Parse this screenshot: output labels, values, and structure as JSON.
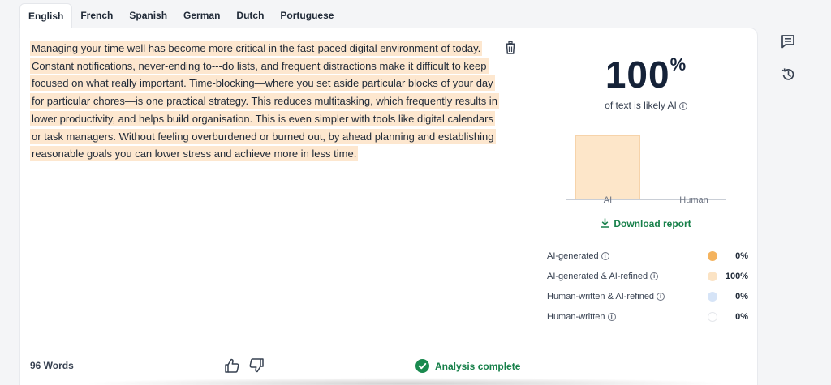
{
  "tabs": [
    {
      "label": "English",
      "active": true
    },
    {
      "label": "French"
    },
    {
      "label": "Spanish"
    },
    {
      "label": "German"
    },
    {
      "label": "Dutch"
    },
    {
      "label": "Portuguese"
    }
  ],
  "editor": {
    "text": "Managing your time well has become more critical in the fast-paced digital environment of today. Constant notifications, never-ending to---do lists, and frequent distractions make it difficult to keep focused on what really important. Time-blocking—where you set aside particular blocks of your day for particular chores—is one practical strategy. This reduces multitasking, which frequently results in lower productivity, and helps build organisation. This is even simpler with tools like digital calendars or task managers. Without feeling overburdened or burned out, by ahead planning and establishing reasonable goals you can lower stress and achieve more in less time.",
    "word_count": "96 Words",
    "status": "Analysis complete"
  },
  "results": {
    "percent": "100",
    "percent_sign": "%",
    "likely_label": "of text is likely AI",
    "download_label": "Download report"
  },
  "chart_data": {
    "type": "bar",
    "categories": [
      "AI",
      "Human"
    ],
    "values": [
      100,
      0
    ],
    "ylim": [
      0,
      100
    ]
  },
  "legend": [
    {
      "label": "AI-generated",
      "value": "0%",
      "color": "#f4b35e"
    },
    {
      "label": "AI-generated & AI-refined",
      "value": "100%",
      "color": "#fbe3c4"
    },
    {
      "label": "Human-written & AI-refined",
      "value": "0%",
      "color": "#d6e4f7"
    },
    {
      "label": "Human-written",
      "value": "0%",
      "color": "#ffffff"
    }
  ],
  "icons": {
    "comments": "chat-icon",
    "history": "history-icon",
    "delete": "trash-icon",
    "like": "thumbs-up-icon",
    "dislike": "thumbs-down-icon",
    "status": "check-circle-icon",
    "download": "download-icon"
  }
}
